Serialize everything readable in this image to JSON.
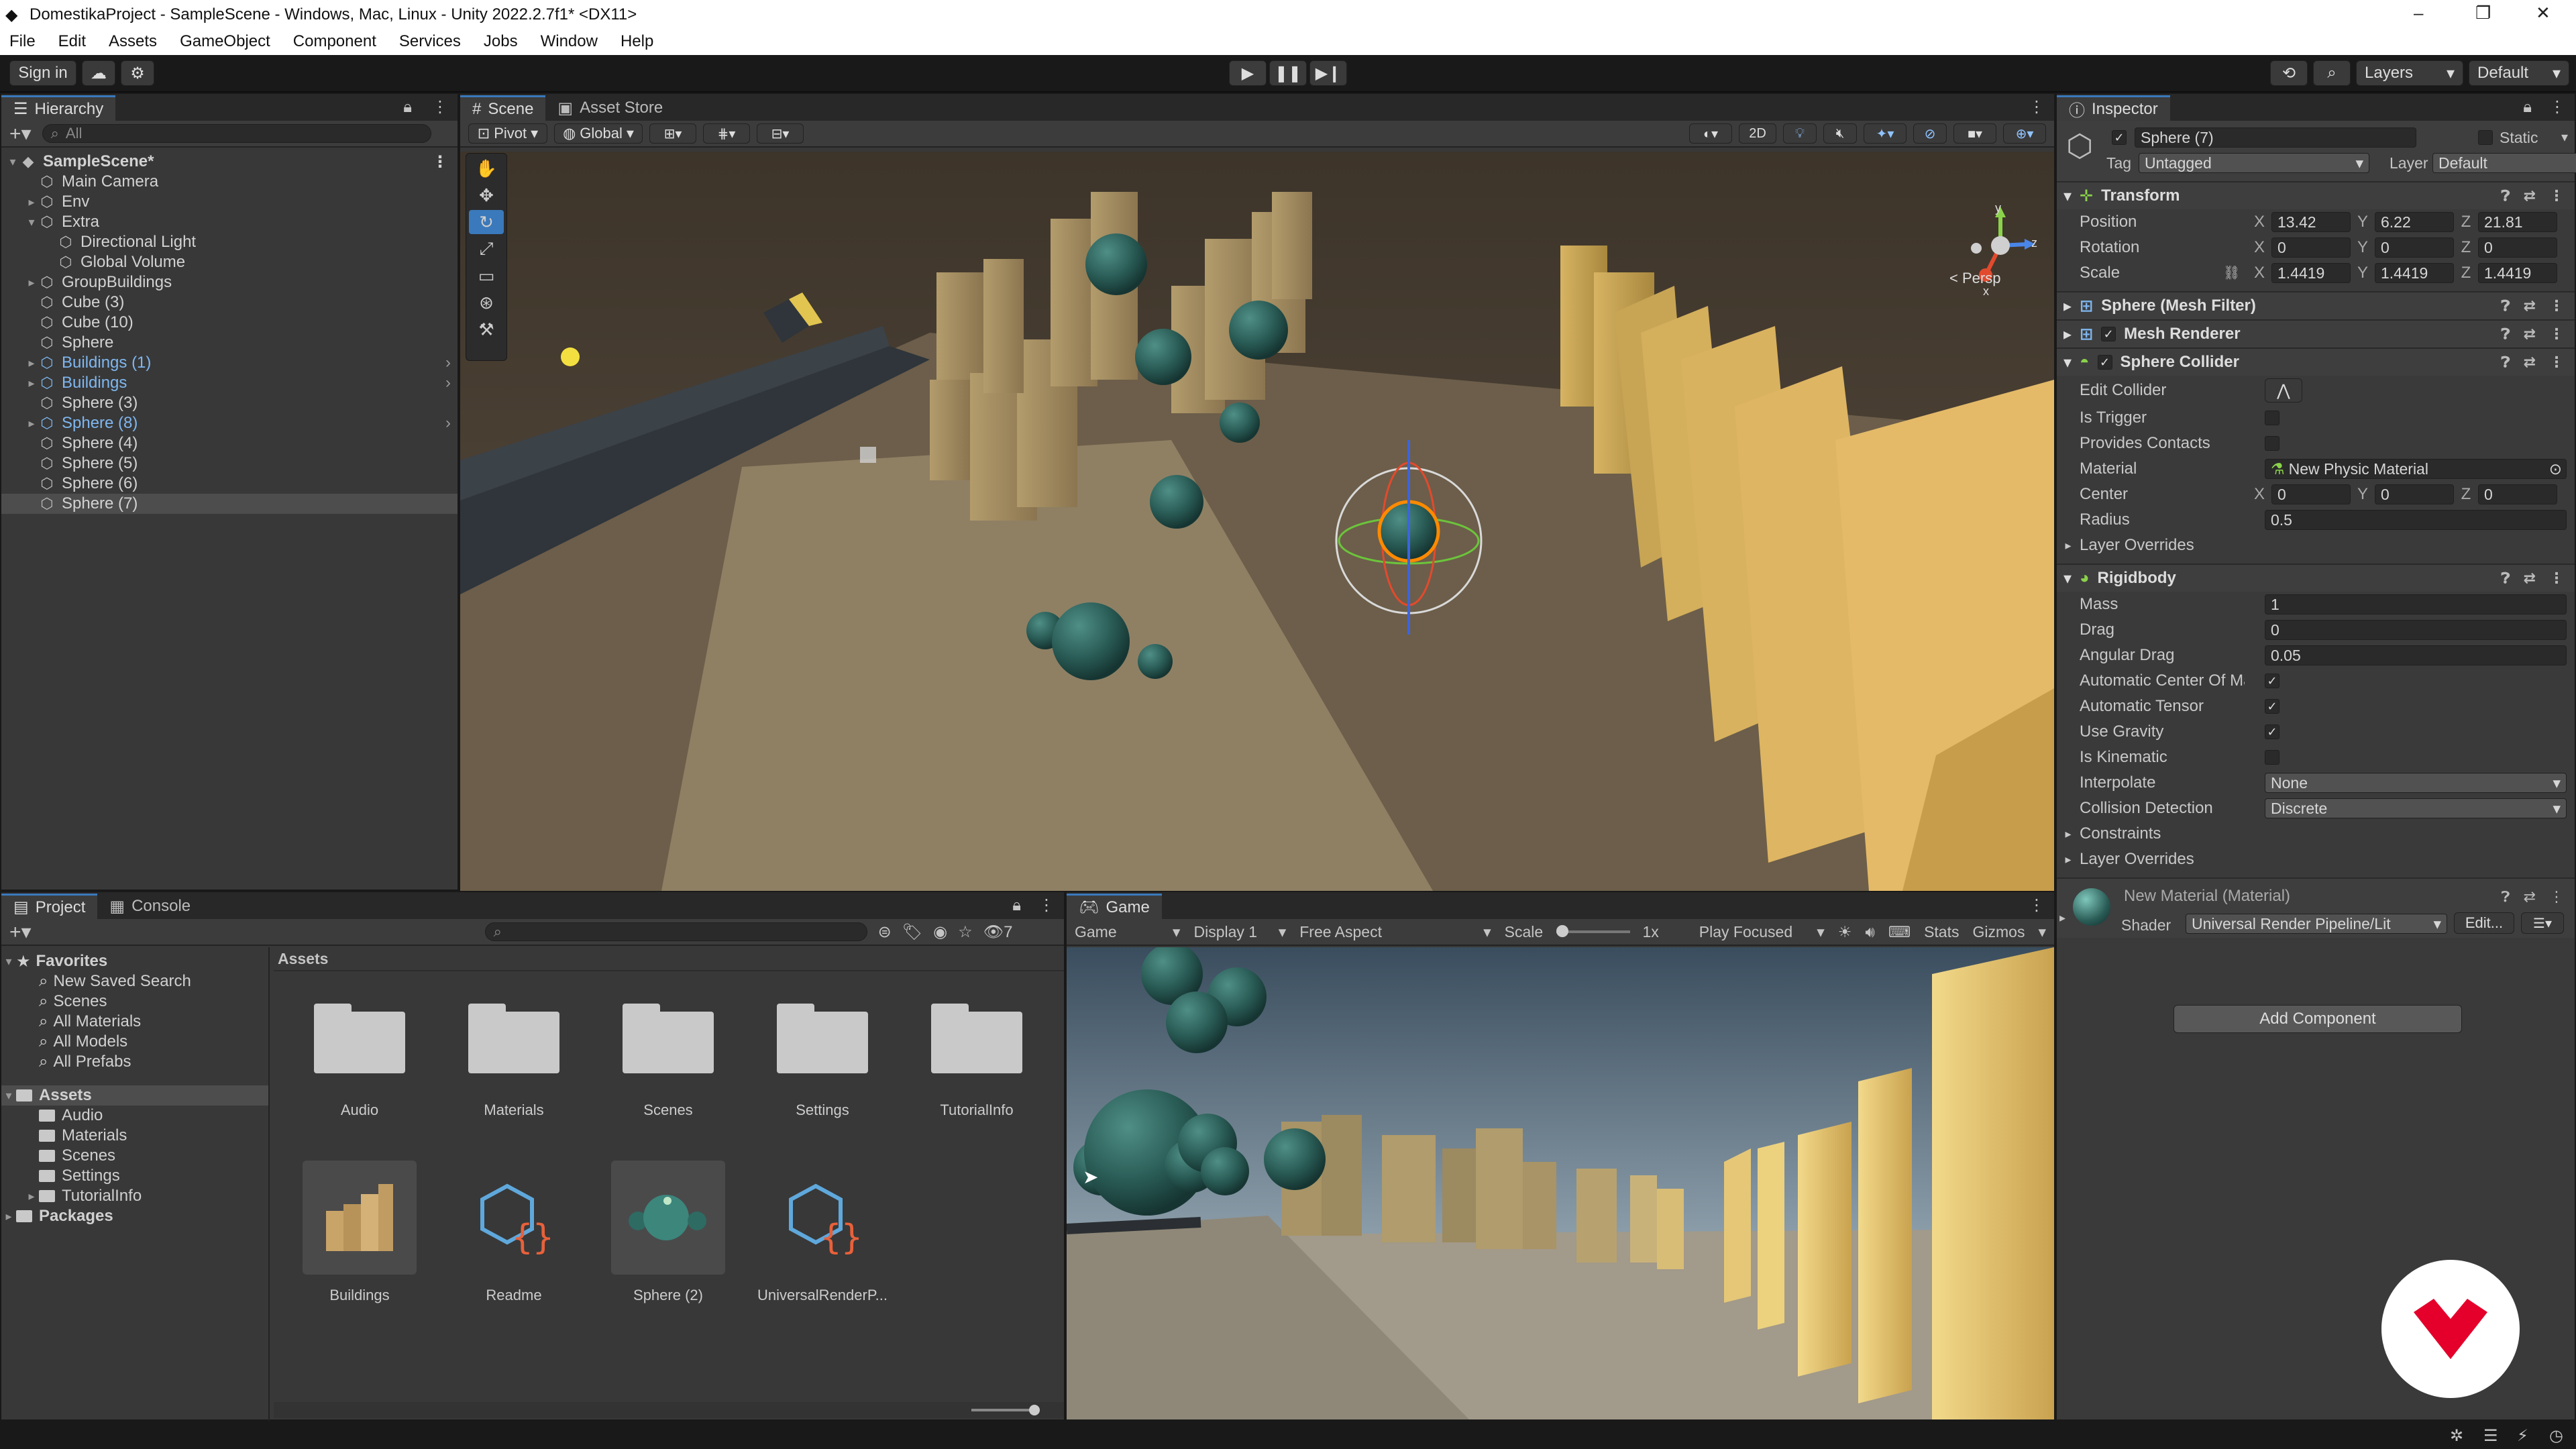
{
  "window": {
    "title": "DomestikaProject - SampleScene - Windows, Mac, Linux - Unity 2022.2.7f1* <DX11>"
  },
  "menu": [
    "File",
    "Edit",
    "Assets",
    "GameObject",
    "Component",
    "Services",
    "Jobs",
    "Window",
    "Help"
  ],
  "toolbar": {
    "sign_in": "Sign in",
    "layers": "Layers",
    "layout": "Default"
  },
  "hierarchy": {
    "tab": "Hierarchy",
    "search_placeholder": "All",
    "items": [
      {
        "label": "SampleScene*",
        "depth": 0,
        "bold": true,
        "expanded": true
      },
      {
        "label": "Main Camera",
        "depth": 1
      },
      {
        "label": "Env",
        "depth": 1,
        "arrow": "right"
      },
      {
        "label": "Extra",
        "depth": 1,
        "arrow": "down"
      },
      {
        "label": "Directional Light",
        "depth": 2
      },
      {
        "label": "Global Volume",
        "depth": 2
      },
      {
        "label": "GroupBuildings",
        "depth": 1,
        "arrow": "right"
      },
      {
        "label": "Cube (3)",
        "depth": 1
      },
      {
        "label": "Cube (10)",
        "depth": 1
      },
      {
        "label": "Sphere",
        "depth": 1
      },
      {
        "label": "Buildings (1)",
        "depth": 1,
        "arrow": "right",
        "prefab": true
      },
      {
        "label": "Buildings",
        "depth": 1,
        "arrow": "right",
        "prefab": true
      },
      {
        "label": "Sphere (3)",
        "depth": 1
      },
      {
        "label": "Sphere (8)",
        "depth": 1,
        "arrow": "right",
        "prefab": true
      },
      {
        "label": "Sphere (4)",
        "depth": 1
      },
      {
        "label": "Sphere (5)",
        "depth": 1
      },
      {
        "label": "Sphere (6)",
        "depth": 1
      },
      {
        "label": "Sphere (7)",
        "depth": 1,
        "selected": true
      }
    ]
  },
  "scene": {
    "tabs": [
      "Scene",
      "Asset Store"
    ],
    "pivot": "Pivot",
    "global": "Global",
    "mode_2d": "2D",
    "persp": "< Persp",
    "axis_y": "y",
    "axis_z": "z",
    "axis_x": "x"
  },
  "inspector": {
    "tab": "Inspector",
    "object_name": "Sphere (7)",
    "static_label": "Static",
    "tag_label": "Tag",
    "tag": "Untagged",
    "layer_label": "Layer",
    "layer": "Default",
    "transform": {
      "title": "Transform",
      "position_label": "Position",
      "position": {
        "x": "13.42",
        "y": "6.22",
        "z": "21.81"
      },
      "rotation_label": "Rotation",
      "rotation": {
        "x": "0",
        "y": "0",
        "z": "0"
      },
      "scale_label": "Scale",
      "scale": {
        "x": "1.4419",
        "y": "1.4419",
        "z": "1.4419"
      }
    },
    "mesh_filter": "Sphere (Mesh Filter)",
    "mesh_renderer": "Mesh Renderer",
    "sphere_collider": {
      "title": "Sphere Collider",
      "edit_collider": "Edit Collider",
      "is_trigger": "Is Trigger",
      "provides_contacts": "Provides Contacts",
      "material_label": "Material",
      "material": "New Physic Material",
      "center_label": "Center",
      "center": {
        "x": "0",
        "y": "0",
        "z": "0"
      },
      "radius_label": "Radius",
      "radius": "0.5",
      "layer_overrides": "Layer Overrides"
    },
    "rigidbody": {
      "title": "Rigidbody",
      "mass_label": "Mass",
      "mass": "1",
      "drag_label": "Drag",
      "drag": "0",
      "angular_drag_label": "Angular Drag",
      "angular_drag": "0.05",
      "auto_com_label": "Automatic Center Of Mass",
      "auto_tensor_label": "Automatic Tensor",
      "use_gravity_label": "Use Gravity",
      "is_kinematic_label": "Is Kinematic",
      "interpolate_label": "Interpolate",
      "interpolate": "None",
      "collision_label": "Collision Detection",
      "collision": "Discrete",
      "constraints": "Constraints",
      "layer_overrides": "Layer Overrides"
    },
    "material": {
      "name": "New Material (Material)",
      "shader_label": "Shader",
      "shader": "Universal Render Pipeline/Lit",
      "edit": "Edit..."
    },
    "add_component": "Add Component"
  },
  "project": {
    "tabs": [
      "Project",
      "Console"
    ],
    "hidden_count": "7",
    "favorites": {
      "label": "Favorites",
      "items": [
        "New Saved Search",
        "Scenes",
        "All Materials",
        "All Models",
        "All Prefabs"
      ]
    },
    "assets_tree": {
      "label": "Assets",
      "items": [
        "Audio",
        "Materials",
        "Scenes",
        "Settings",
        "TutorialInfo"
      ]
    },
    "packages": "Packages",
    "breadcrumb": "Assets",
    "grid": [
      {
        "label": "Audio",
        "kind": "folder"
      },
      {
        "label": "Materials",
        "kind": "folder"
      },
      {
        "label": "Scenes",
        "kind": "folder"
      },
      {
        "label": "Settings",
        "kind": "folder"
      },
      {
        "label": "TutorialInfo",
        "kind": "folder"
      },
      {
        "label": "Buildings",
        "kind": "prefab"
      },
      {
        "label": "Readme",
        "kind": "script"
      },
      {
        "label": "Sphere (2)",
        "kind": "sphere"
      },
      {
        "label": "UniversalRenderP...",
        "kind": "script"
      }
    ]
  },
  "game": {
    "tab": "Game",
    "mode": "Game",
    "display": "Display 1",
    "aspect": "Free Aspect",
    "scale_label": "Scale",
    "scale_value": "1x",
    "play": "Play Focused",
    "stats": "Stats",
    "gizmos": "Gizmos"
  },
  "colors": {
    "accent": "#3a79bb",
    "brand_red": "#e4002b",
    "prefab_blue": "#7fb7f0",
    "panel": "#383838"
  }
}
